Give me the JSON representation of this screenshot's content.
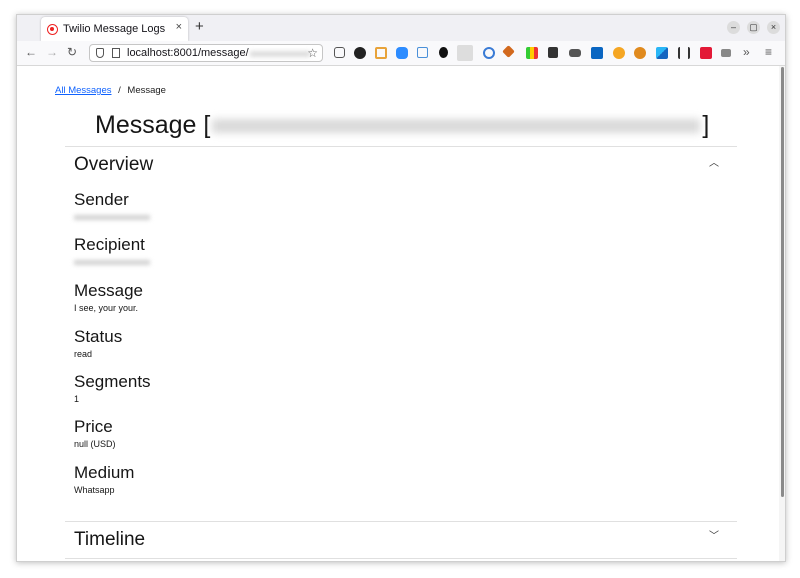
{
  "browser": {
    "tab_title": "Twilio Message Logs",
    "tab_close": "×",
    "new_tab": "+",
    "url": "localhost:8001/message/",
    "window_min": "–",
    "window_max": "▢",
    "window_close": "×"
  },
  "breadcrumb": {
    "link": "All Messages",
    "separator": "/",
    "current": "Message"
  },
  "page": {
    "title_prefix": "Message [",
    "title_suffix": "]"
  },
  "overview": {
    "title": "Overview",
    "fields": {
      "sender": {
        "label": "Sender"
      },
      "recipient": {
        "label": "Recipient"
      },
      "message": {
        "label": "Message",
        "value": "I see, your your."
      },
      "status": {
        "label": "Status",
        "value": "read"
      },
      "segments": {
        "label": "Segments",
        "value": "1"
      },
      "price": {
        "label": "Price",
        "value": "null (USD)"
      },
      "medium": {
        "label": "Medium",
        "value": "Whatsapp"
      }
    }
  },
  "timeline": {
    "title": "Timeline"
  },
  "icons": {
    "expanded": "chevron-up-icon",
    "collapsed": "chevron-down-icon"
  }
}
